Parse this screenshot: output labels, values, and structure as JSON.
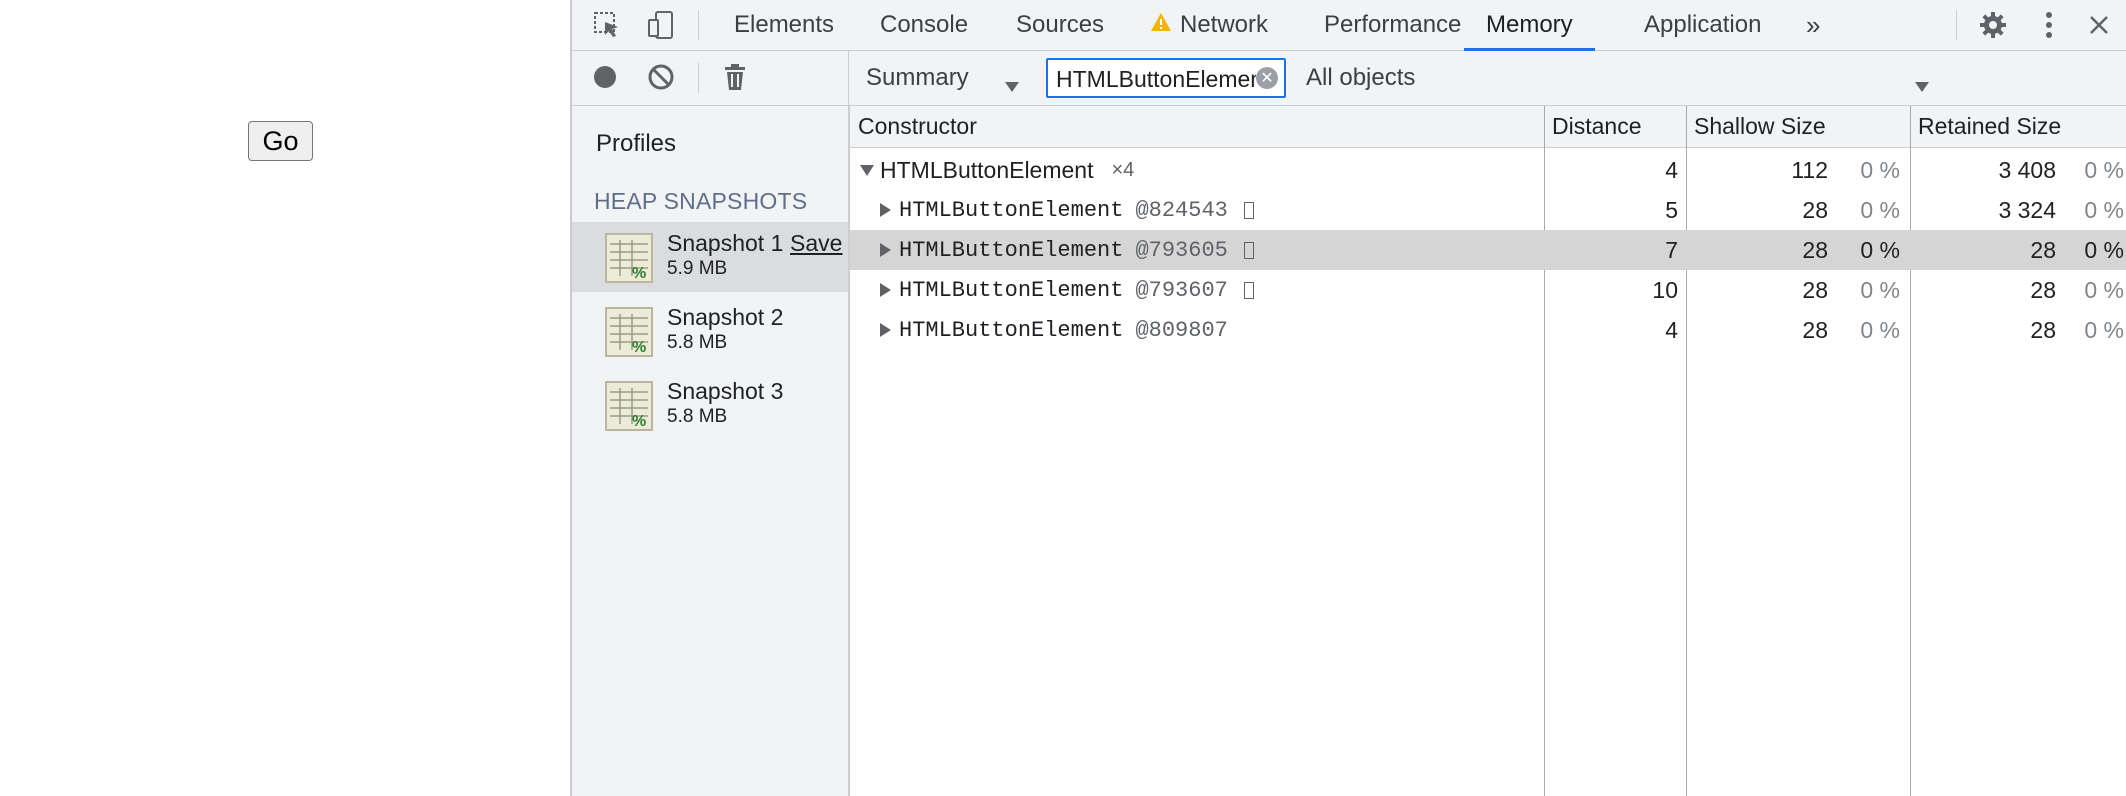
{
  "page": {
    "go_button": "Go"
  },
  "devtools": {
    "tabs": [
      {
        "label": "Elements"
      },
      {
        "label": "Console"
      },
      {
        "label": "Sources"
      },
      {
        "label": "Network"
      },
      {
        "label": "Performance"
      },
      {
        "label": "Memory"
      },
      {
        "label": "Application"
      }
    ],
    "active_tab": "Memory",
    "more_tabs": "»",
    "accent": "#1a73e8",
    "warning_color": "#f4b400"
  },
  "toolbar": {
    "view_select": "Summary",
    "filter_value": "HTMLButtonElement",
    "objects_select": "All objects"
  },
  "sidebar": {
    "profiles_label": "Profiles",
    "section_title": "HEAP SNAPSHOTS",
    "snapshots": [
      {
        "name": "Snapshot 1",
        "size": "5.9 MB",
        "save": "Save"
      },
      {
        "name": "Snapshot 2",
        "size": "5.8 MB"
      },
      {
        "name": "Snapshot 3",
        "size": "5.8 MB"
      }
    ]
  },
  "table": {
    "headers": {
      "constructor": "Constructor",
      "distance": "Distance",
      "shallow": "Shallow Size",
      "retained": "Retained Size"
    },
    "group": {
      "name": "HTMLButtonElement",
      "count": "×4",
      "distance": "4",
      "shallow": "112",
      "shallow_pct": "0 %",
      "retained": "3 408",
      "retained_pct": "0 %"
    },
    "rows": [
      {
        "name": "HTMLButtonElement",
        "id": "@824543",
        "distance": "5",
        "shallow": "28",
        "shallow_pct": "0 %",
        "retained": "3 324",
        "retained_pct": "0 %"
      },
      {
        "name": "HTMLButtonElement",
        "id": "@793605",
        "distance": "7",
        "shallow": "28",
        "shallow_pct": "0 %",
        "retained": "28",
        "retained_pct": "0 %"
      },
      {
        "name": "HTMLButtonElement",
        "id": "@793607",
        "distance": "10",
        "shallow": "28",
        "shallow_pct": "0 %",
        "retained": "28",
        "retained_pct": "0 %"
      },
      {
        "name": "HTMLButtonElement",
        "id": "@809807",
        "distance": "4",
        "shallow": "28",
        "shallow_pct": "0 %",
        "retained": "28",
        "retained_pct": "0 %"
      }
    ]
  }
}
